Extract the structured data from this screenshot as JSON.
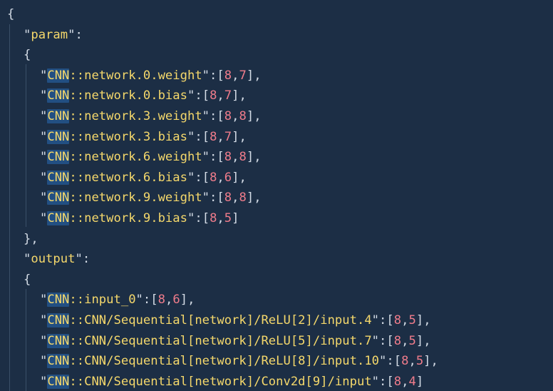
{
  "editor": {
    "open_brace": "{",
    "sections": [
      {
        "key": "param",
        "open": "{",
        "close": "},",
        "entries": [
          {
            "prefix": "CNN",
            "rest": "::network.0.weight",
            "values": [
              "8",
              "7"
            ],
            "trail": ","
          },
          {
            "prefix": "CNN",
            "rest": "::network.0.bias",
            "values": [
              "8",
              "7"
            ],
            "trail": ","
          },
          {
            "prefix": "CNN",
            "rest": "::network.3.weight",
            "values": [
              "8",
              "8"
            ],
            "trail": ","
          },
          {
            "prefix": "CNN",
            "rest": "::network.3.bias",
            "values": [
              "8",
              "7"
            ],
            "trail": ","
          },
          {
            "prefix": "CNN",
            "rest": "::network.6.weight",
            "values": [
              "8",
              "8"
            ],
            "trail": ","
          },
          {
            "prefix": "CNN",
            "rest": "::network.6.bias",
            "values": [
              "8",
              "6"
            ],
            "trail": ","
          },
          {
            "prefix": "CNN",
            "rest": "::network.9.weight",
            "values": [
              "8",
              "8"
            ],
            "trail": ","
          },
          {
            "prefix": "CNN",
            "rest": "::network.9.bias",
            "values": [
              "8",
              "5"
            ],
            "trail": ""
          }
        ]
      },
      {
        "key": "output",
        "open": "{",
        "entries": [
          {
            "prefix": "CNN",
            "rest": "::input_0",
            "values": [
              "8",
              "6"
            ],
            "trail": ","
          },
          {
            "prefix": "CNN",
            "rest": "::CNN/Sequential[network]/ReLU[2]/input.4",
            "values": [
              "8",
              "5"
            ],
            "trail": ","
          },
          {
            "prefix": "CNN",
            "rest": "::CNN/Sequential[network]/ReLU[5]/input.7",
            "values": [
              "8",
              "5"
            ],
            "trail": ","
          },
          {
            "prefix": "CNN",
            "rest": "::CNN/Sequential[network]/ReLU[8]/input.10",
            "values": [
              "8",
              "5"
            ],
            "trail": ","
          },
          {
            "prefix": "CNN",
            "rest": "::CNN/Sequential[network]/Conv2d[9]/input",
            "values": [
              "8",
              "4"
            ],
            "trail": ""
          }
        ]
      }
    ]
  },
  "colors": {
    "background": "#1c2e45",
    "key": "#f5d86b",
    "number": "#f07c8b",
    "punctuation": "#d4dce6",
    "selection_highlight": "#224f82"
  }
}
